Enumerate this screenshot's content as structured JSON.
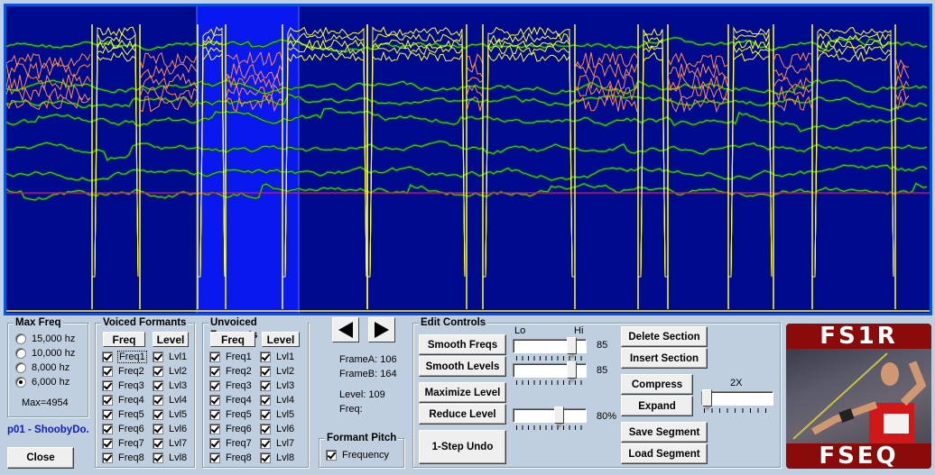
{
  "display": {
    "selection": {
      "frame_a": 106,
      "frame_b": 164
    },
    "colors": {
      "background": "#000a8c",
      "border": "#0a55d6",
      "selection": "#0a18f0",
      "formant_freq": "#3cdc3c",
      "pitch": "#e0106a",
      "voiced_level": "#ffff30",
      "unvoiced_level": "#ff8c50"
    }
  },
  "max_freq": {
    "title": "Max Freq",
    "options": [
      {
        "label": "15,000 hz",
        "checked": false
      },
      {
        "label": "10,000 hz",
        "checked": false
      },
      {
        "label": "8,000 hz",
        "checked": false
      },
      {
        "label": "6,000 hz",
        "checked": true
      }
    ],
    "max_text": "Max=4954"
  },
  "file_label": "p01 - ShoobyDo.",
  "close_label": "Close",
  "voiced": {
    "title": "Voiced Formants",
    "freq_btn": "Freq",
    "level_btn": "Level",
    "freqs": [
      "Freq1",
      "Freq2",
      "Freq3",
      "Freq4",
      "Freq5",
      "Freq6",
      "Freq7",
      "Freq8"
    ],
    "levels": [
      "Lvl1",
      "Lvl2",
      "Lvl3",
      "Lvl4",
      "Lvl5",
      "Lvl6",
      "Lvl7",
      "Lvl8"
    ]
  },
  "unvoiced": {
    "title": "Unvoiced Formants",
    "freq_btn": "Freq",
    "level_btn": "Level",
    "freqs": [
      "Freq1",
      "Freq2",
      "Freq3",
      "Freq4",
      "Freq5",
      "Freq6",
      "Freq7",
      "Freq8"
    ],
    "levels": [
      "Lvl1",
      "Lvl2",
      "Lvl3",
      "Lvl4",
      "Lvl5",
      "Lvl6",
      "Lvl7",
      "Lvl8"
    ]
  },
  "nav": {
    "prev": "previous-frame",
    "next": "next-frame"
  },
  "info": {
    "frame_a": "FrameA: 106",
    "frame_b": "FrameB: 164",
    "level": "Level: 109",
    "freq": "Freq:"
  },
  "formant_pitch": {
    "title": "Formant Pitch",
    "frequency_label": "Frequency",
    "frequency_checked": true
  },
  "edit": {
    "title": "Edit Controls",
    "lo": "Lo",
    "hi": "Hi",
    "smooth_freqs": "Smooth Freqs",
    "smooth_levels": "Smooth Levels",
    "maximize_level": "Maximize Level",
    "reduce_level": "Reduce Level",
    "undo": "1-Step Undo",
    "smooth_freqs_value": "85",
    "smooth_levels_value": "85",
    "reduce_value": "80%",
    "smooth_freqs_pos": 0.85,
    "smooth_levels_pos": 0.85,
    "reduce_pos": 0.65,
    "delete_section": "Delete Section",
    "insert_section": "Insert Section",
    "compress": "Compress",
    "expand": "Expand",
    "ratio_label": "2X",
    "ratio_pos": 0.0,
    "save_segment": "Save Segment",
    "load_segment": "Load Segment"
  },
  "logo": {
    "top": "FS1R",
    "bottom": "FSEQ"
  }
}
